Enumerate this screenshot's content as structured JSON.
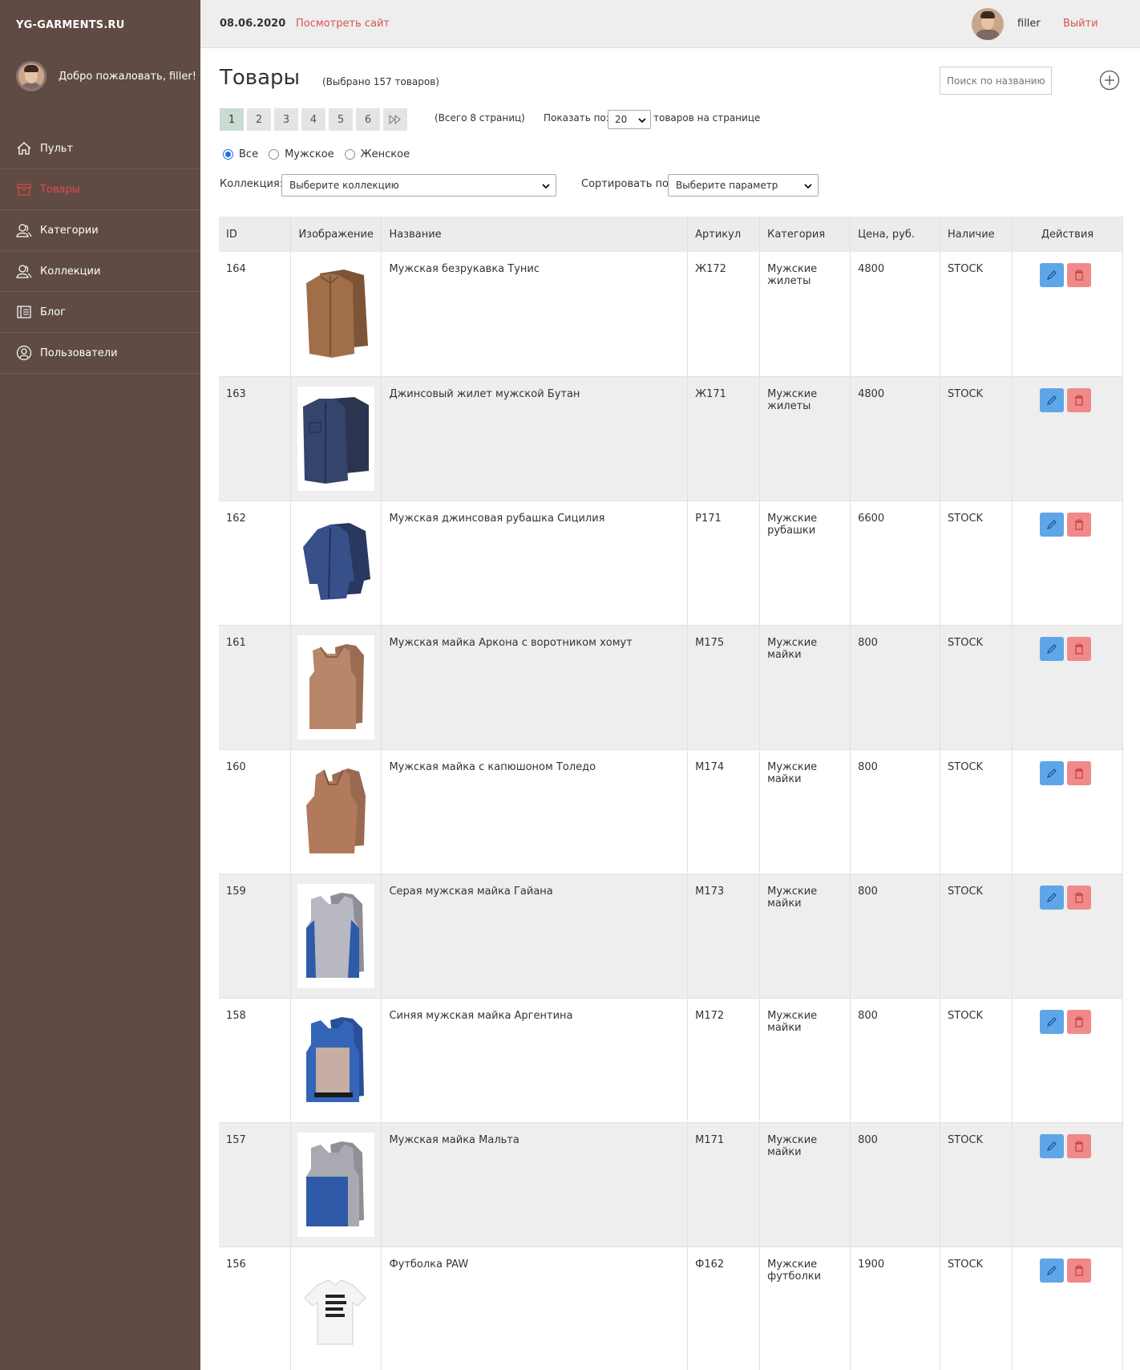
{
  "brand": "YG-GARMENTS.RU",
  "welcome": "Добро пожаловать, filler!",
  "nav": [
    {
      "label": "Пульт",
      "icon": "home-icon"
    },
    {
      "label": "Товары",
      "icon": "box-icon",
      "active": true
    },
    {
      "label": "Категории",
      "icon": "users-icon"
    },
    {
      "label": "Коллекции",
      "icon": "users-icon"
    },
    {
      "label": "Блог",
      "icon": "blog-icon"
    },
    {
      "label": "Пользователи",
      "icon": "user-circle-icon"
    }
  ],
  "topbar": {
    "date": "08.06.2020",
    "view_site": "Посмотреть сайт",
    "username": "filler",
    "logout": "Выйти"
  },
  "page": {
    "title": "Товары",
    "selected": "(Выбрано 157 товаров)",
    "search_placeholder": "Поиск по названию товара",
    "pages": [
      "1",
      "2",
      "3",
      "4",
      "5",
      "6"
    ],
    "active_page": "1",
    "pages_total": "(Всего 8 страниц)",
    "show_label": "Показать по:",
    "per_page": "20",
    "per_page_suffix": "товаров на странице"
  },
  "gender_filter": {
    "options": [
      "Все",
      "Мужское",
      "Женское"
    ],
    "selected": "Все"
  },
  "filters": {
    "collection_label": "Коллекция:",
    "collection_value": "Выберите коллекцию",
    "sort_label": "Сортировать по:",
    "sort_value": "Выберите параметр"
  },
  "table": {
    "headers": [
      "ID",
      "Изображение",
      "Название",
      "Артикул",
      "Категория",
      "Цена, руб.",
      "Наличие",
      "Действия"
    ],
    "rows": [
      {
        "id": "164",
        "name": "Мужская безрукавка Тунис",
        "sku": "Ж172",
        "category": "Мужские жилеты",
        "price": "4800",
        "stock": "STOCK",
        "img": "vest-brown-icon"
      },
      {
        "id": "163",
        "name": "Джинсовый жилет мужской Бутан",
        "sku": "Ж171",
        "category": "Мужские жилеты",
        "price": "4800",
        "stock": "STOCK",
        "img": "vest-denim-icon"
      },
      {
        "id": "162",
        "name": "Мужская джинсовая рубашка Сицилия",
        "sku": "Р171",
        "category": "Мужские рубашки",
        "price": "6600",
        "stock": "STOCK",
        "img": "shirt-denim-icon"
      },
      {
        "id": "161",
        "name": "Мужская майка Аркона с воротником хомут",
        "sku": "М175",
        "category": "Мужские майки",
        "price": "800",
        "stock": "STOCK",
        "img": "tank-brown-icon"
      },
      {
        "id": "160",
        "name": "Мужская майка с капюшоном Толедо",
        "sku": "М174",
        "category": "Мужские майки",
        "price": "800",
        "stock": "STOCK",
        "img": "tank-hood-brown-icon"
      },
      {
        "id": "159",
        "name": "Серая мужская майка Гайана",
        "sku": "М173",
        "category": "Мужские майки",
        "price": "800",
        "stock": "STOCK",
        "img": "tank-grey-blue-icon"
      },
      {
        "id": "158",
        "name": "Синяя мужская майка Аргентина",
        "sku": "М172",
        "category": "Мужские майки",
        "price": "800",
        "stock": "STOCK",
        "img": "tank-blue-icon"
      },
      {
        "id": "157",
        "name": "Мужская майка Мальта",
        "sku": "М171",
        "category": "Мужские майки",
        "price": "800",
        "stock": "STOCK",
        "img": "tank-blue-grey-icon"
      },
      {
        "id": "156",
        "name": "Футболка PAW",
        "sku": "Ф162",
        "category": "Мужские футболки",
        "price": "1900",
        "stock": "STOCK",
        "img": "tshirt-white-icon"
      }
    ]
  },
  "colors": {
    "sidebar": "#5f4b43",
    "accent": "#d9534f",
    "edit": "#5ea6e8",
    "delete": "#f08a8a"
  }
}
